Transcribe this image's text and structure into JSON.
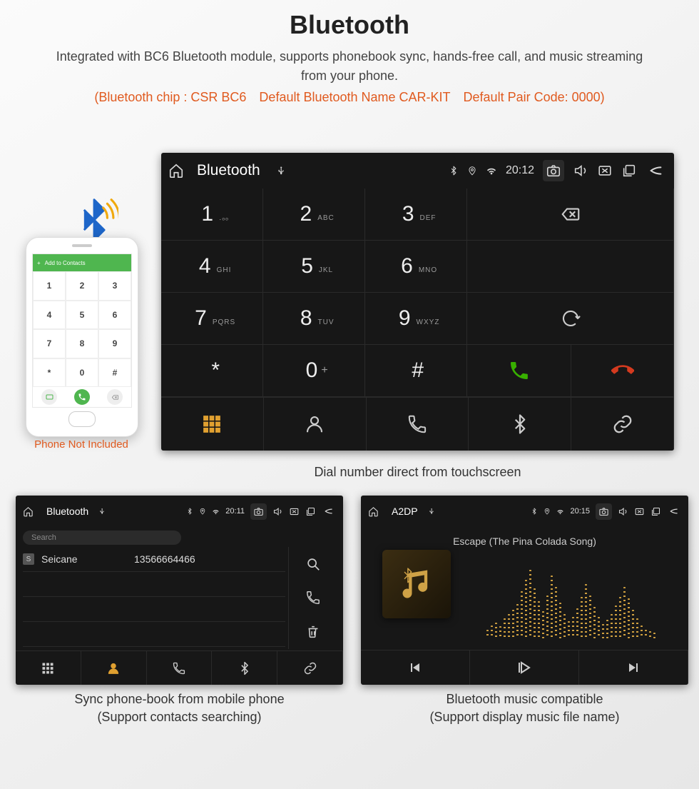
{
  "header": {
    "title": "Bluetooth",
    "subtitle": "Integrated with BC6 Bluetooth module, supports phonebook sync, hands-free call, and music streaming from your phone.",
    "specline": "(Bluetooth chip : CSR BC6 Default Bluetooth Name CAR-KIT Default Pair Code: 0000)"
  },
  "dialer": {
    "bar_title": "Bluetooth",
    "clock": "20:12",
    "keys": [
      {
        "num": "1",
        "sub": "․ₒₒ"
      },
      {
        "num": "2",
        "sub": "ABC"
      },
      {
        "num": "3",
        "sub": "DEF"
      },
      {
        "num": "4",
        "sub": "GHI"
      },
      {
        "num": "5",
        "sub": "JKL"
      },
      {
        "num": "6",
        "sub": "MNO"
      },
      {
        "num": "7",
        "sub": "PQRS"
      },
      {
        "num": "8",
        "sub": "TUV"
      },
      {
        "num": "9",
        "sub": "WXYZ"
      },
      {
        "num": "*",
        "sub": ""
      },
      {
        "num": "0",
        "sub": "+",
        "supsub": true
      },
      {
        "num": "#",
        "sub": ""
      }
    ],
    "caption": "Dial number direct from touchscreen"
  },
  "contacts": {
    "bar_title": "Bluetooth",
    "clock": "20:11",
    "search_placeholder": "Search",
    "rows": [
      {
        "tag": "S",
        "name": "Seicane",
        "number": "13566664466"
      }
    ],
    "caption_l1": "Sync phone-book from mobile phone",
    "caption_l2": "(Support contacts searching)"
  },
  "music": {
    "bar_title": "A2DP",
    "clock": "20:15",
    "track": "Escape (The Pina Colada Song)",
    "caption_l1": "Bluetooth music compatible",
    "caption_l2": "(Support display music file name)"
  },
  "phone_mock": {
    "header": "Add to Contacts",
    "keys": [
      "1",
      "2",
      "3",
      "4",
      "5",
      "6",
      "7",
      "8",
      "9",
      "*",
      "0",
      "#"
    ],
    "caption": "Phone Not Included"
  },
  "colors": {
    "accent": "#e05a1f",
    "call_green": "#38b000",
    "call_red": "#d43a1f",
    "nav_active": "#e0a030"
  }
}
